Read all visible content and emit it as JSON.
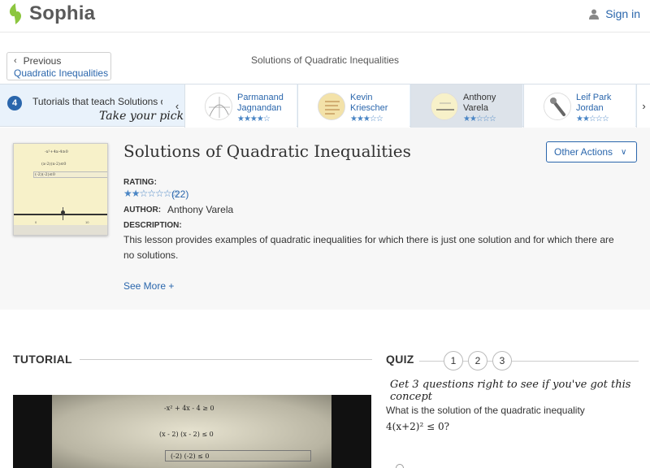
{
  "header": {
    "brand": "Sophia",
    "signin_label": "Sign in",
    "colors": {
      "brand_green": "#8CC63F",
      "link_blue": "#2a66ac"
    }
  },
  "breadcrumb": {
    "previous_label": "Previous",
    "previous_target": "Quadratic Inequalities",
    "page_title": "Solutions of Quadratic Inequalities"
  },
  "tutorials_strip": {
    "count": "4",
    "label": "Tutorials that teach Solutions of",
    "pick_text": "Take your pick:",
    "cards": [
      {
        "name": "Parmanand Jagnandan",
        "stars": "★★★★☆",
        "icon": "graph-thumbnail",
        "active": false
      },
      {
        "name": "Kevin Kriescher",
        "stars": "★★★☆☆",
        "icon": "notes-thumbnail",
        "active": false
      },
      {
        "name": "Anthony Varela",
        "stars": "★★☆☆☆",
        "icon": "board-thumbnail",
        "active": true
      },
      {
        "name": "Leif Park Jordan",
        "stars": "★★☆☆☆",
        "icon": "tool-thumbnail",
        "active": false
      }
    ]
  },
  "lesson": {
    "title": "Solutions of Quadratic Inequalities",
    "actions_label": "Other Actions",
    "rating_label": "RATING:",
    "rating_stars": "★★☆☆☆☆☆",
    "rating_count": "(22)",
    "author_label": "AUTHOR:",
    "author_name": "Anthony Varela",
    "description_label": "DESCRIPTION:",
    "description": "This lesson provides examples of quadratic inequalities for which there is just one solution and for which there are no solutions.",
    "see_more": "See More +",
    "thumbnail": {
      "line1": "-x²+4x-4≥0",
      "line2": "(x-2)(x-2)≤0",
      "line3": "(-2)(-2)≤0",
      "axis_left": "0",
      "axis_right": "10"
    }
  },
  "tutorial": {
    "heading": "TUTORIAL",
    "video_lines": [
      "-x² + 4x - 4 ≥ 0",
      "(x - 2) (x - 2) ≤ 0",
      "(-2) (-2) ≤ 0"
    ]
  },
  "quiz": {
    "heading": "QUIZ",
    "numbers": [
      "1",
      "2",
      "3"
    ],
    "tagline": "Get 3 questions right to see if you've got this concept",
    "question": "What is the solution of the quadratic inequality",
    "inequality": "4(x+2)² ≤ 0?"
  }
}
